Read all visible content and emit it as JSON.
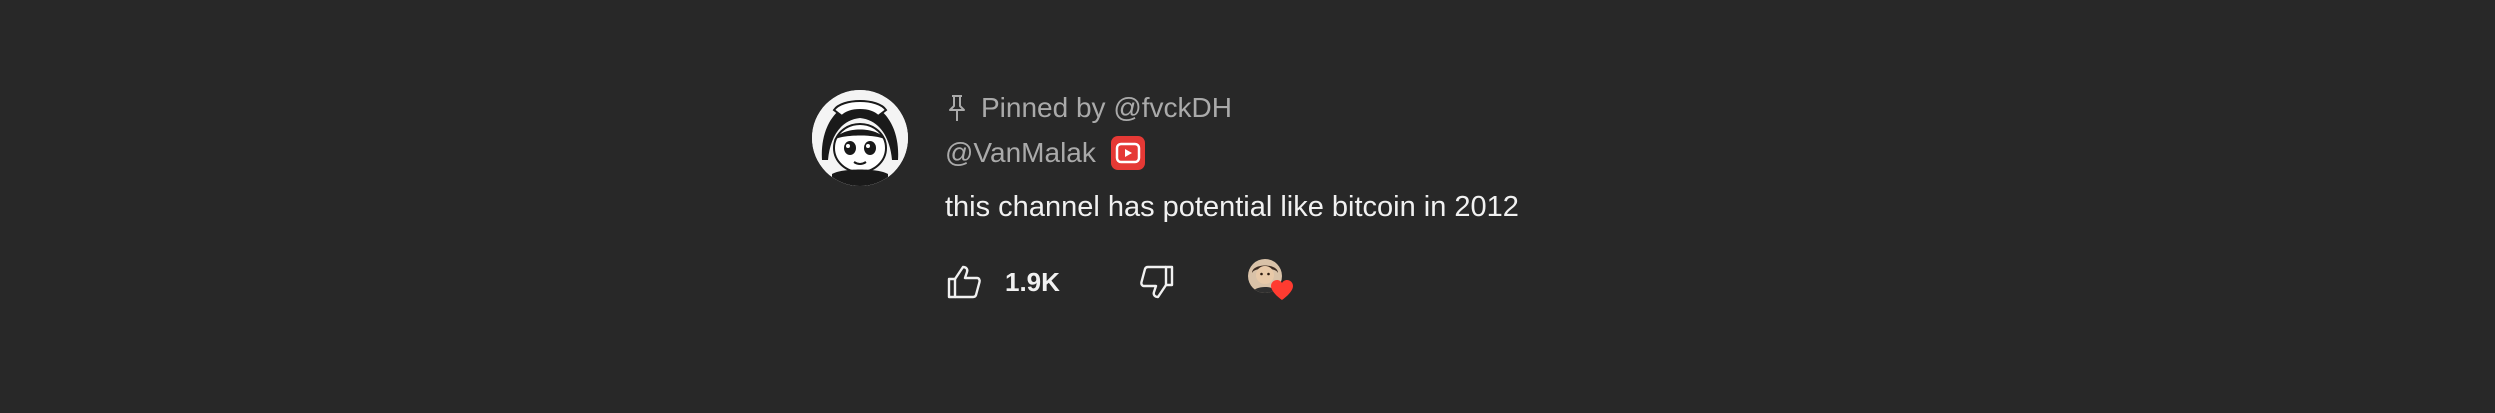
{
  "comment": {
    "pinned_text": "Pinned by @fvckDH",
    "author": "@VanMalak",
    "text": "this channel has potential like bitcoin in 2012",
    "like_count": "1.9K"
  },
  "colors": {
    "background": "#282828",
    "secondary_text": "#aaaaaa",
    "primary_text": "#f1f1f1",
    "badge_red": "#e53935",
    "heart_red": "#ff3b30"
  },
  "icons": {
    "pin": "pin-icon",
    "badge": "youtube-badge-icon",
    "like": "thumbs-up-icon",
    "dislike": "thumbs-down-icon",
    "heart": "heart-icon"
  }
}
